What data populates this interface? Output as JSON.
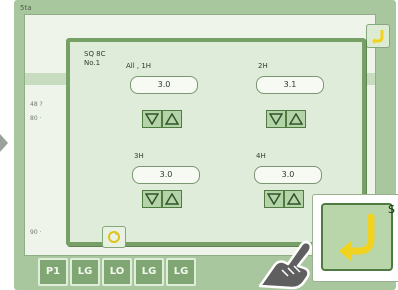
{
  "screen": {
    "top_label": "5ta"
  },
  "background": {
    "rows": [
      "48 ?",
      "80 ·",
      "90 ·"
    ],
    "top_right_button_icon": "return-arrow-icon"
  },
  "bottom_tabs": [
    "P1",
    "LG",
    "LO",
    "LG",
    "LG"
  ],
  "dialog": {
    "title_line1": "SQ 8C",
    "title_line2": "No.1",
    "groups": [
      {
        "label": "All , 1H",
        "value": "3.0"
      },
      {
        "label": "2H",
        "value": "3.1"
      },
      {
        "label": "3H",
        "value": "3.0"
      },
      {
        "label": "4H",
        "value": "3.0"
      }
    ],
    "small_button_icon": "return-arrow-icon"
  },
  "s_button": {
    "letter": "S",
    "icon": "return-arrow-icon"
  },
  "overlay": {
    "pointer": "pointing-hand-icon"
  },
  "colors": {
    "frame": "#a9c79e",
    "dialog_border": "#76a065",
    "button_fill": "#b8d6aa",
    "accent_arrow": "#f1d21f"
  }
}
